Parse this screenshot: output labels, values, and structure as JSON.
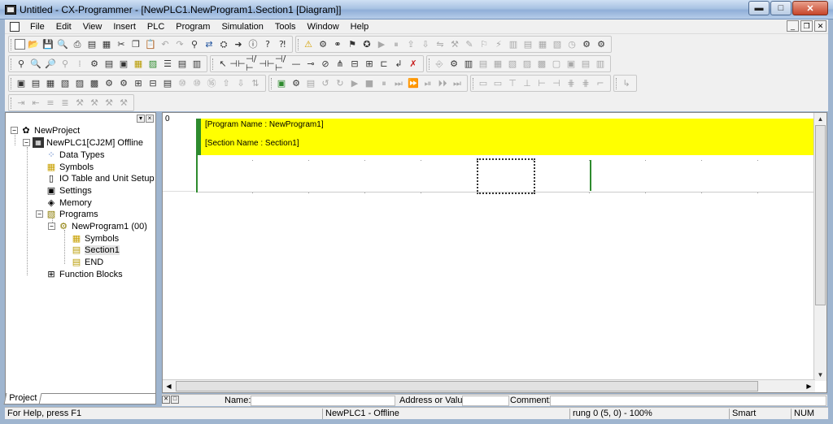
{
  "window": {
    "title": "Untitled - CX-Programmer - [NewPLC1.NewProgram1.Section1 [Diagram]]",
    "buttons": {
      "minimize": "▬",
      "maximize": "□",
      "close": "✕"
    }
  },
  "menubar": {
    "items": [
      "File",
      "Edit",
      "View",
      "Insert",
      "PLC",
      "Program",
      "Simulation",
      "Tools",
      "Window",
      "Help"
    ],
    "mdi_buttons": [
      "_",
      "❐",
      "✕"
    ]
  },
  "toolbar": {
    "row1": [
      "new-icon",
      "open-icon",
      "save-icon",
      "print-preview-icon",
      "print-icon",
      "cut-icon",
      "copy-icon",
      "paste-icon",
      "undo-icon",
      "redo-icon",
      "find-icon",
      "replace-icon",
      "about-icon",
      "help-icon",
      "whats-this-icon",
      "warning-icon",
      "binoculars-icon",
      "monitor-icon",
      "online-icon",
      "work-online-icon"
    ],
    "row2": [
      "zoom-icon",
      "zoom-in-icon",
      "zoom-out-icon",
      "fit-icon",
      "grid-icon",
      "contact-icon",
      "coil-icon",
      "new-contact-icon",
      "select-icon",
      "delete-icon"
    ]
  },
  "project_tree": {
    "expander_open": "−",
    "nodes": [
      {
        "label": "NewProject",
        "icon": "project-icon"
      },
      {
        "label": "NewPLC1[CJ2M] Offline",
        "icon": "plc-icon"
      },
      {
        "label": "Data Types",
        "icon": "data-types-icon"
      },
      {
        "label": "Symbols",
        "icon": "symbols-icon"
      },
      {
        "label": "IO Table and Unit Setup",
        "icon": "io-table-icon"
      },
      {
        "label": "Settings",
        "icon": "settings-icon"
      },
      {
        "label": "Memory",
        "icon": "memory-icon"
      },
      {
        "label": "Programs",
        "icon": "programs-icon"
      },
      {
        "label": "NewProgram1 (00)",
        "icon": "program-icon"
      },
      {
        "label": "Symbols",
        "icon": "symbols-icon"
      },
      {
        "label": "Section1",
        "icon": "section-icon"
      },
      {
        "label": "END",
        "icon": "section-icon"
      },
      {
        "label": "Function Blocks",
        "icon": "function-blocks-icon"
      }
    ],
    "tab_label": "Project"
  },
  "diagram": {
    "rung_number": "0",
    "program_name": "[Program Name : NewProgram1]",
    "section_name": "[Section Name : Section1]",
    "colors": {
      "banner": "#ffff00",
      "rail": "#2e8b2e"
    }
  },
  "infobar": {
    "name_label": "Name:",
    "address_label": "Address or Value:",
    "comment_label": "Comment:"
  },
  "statusbar": {
    "help": "For Help, press F1",
    "plc_status": "NewPLC1 - Offline",
    "position": "rung 0 (5, 0) - 100%",
    "mode": "Smart",
    "num": "NUM"
  }
}
